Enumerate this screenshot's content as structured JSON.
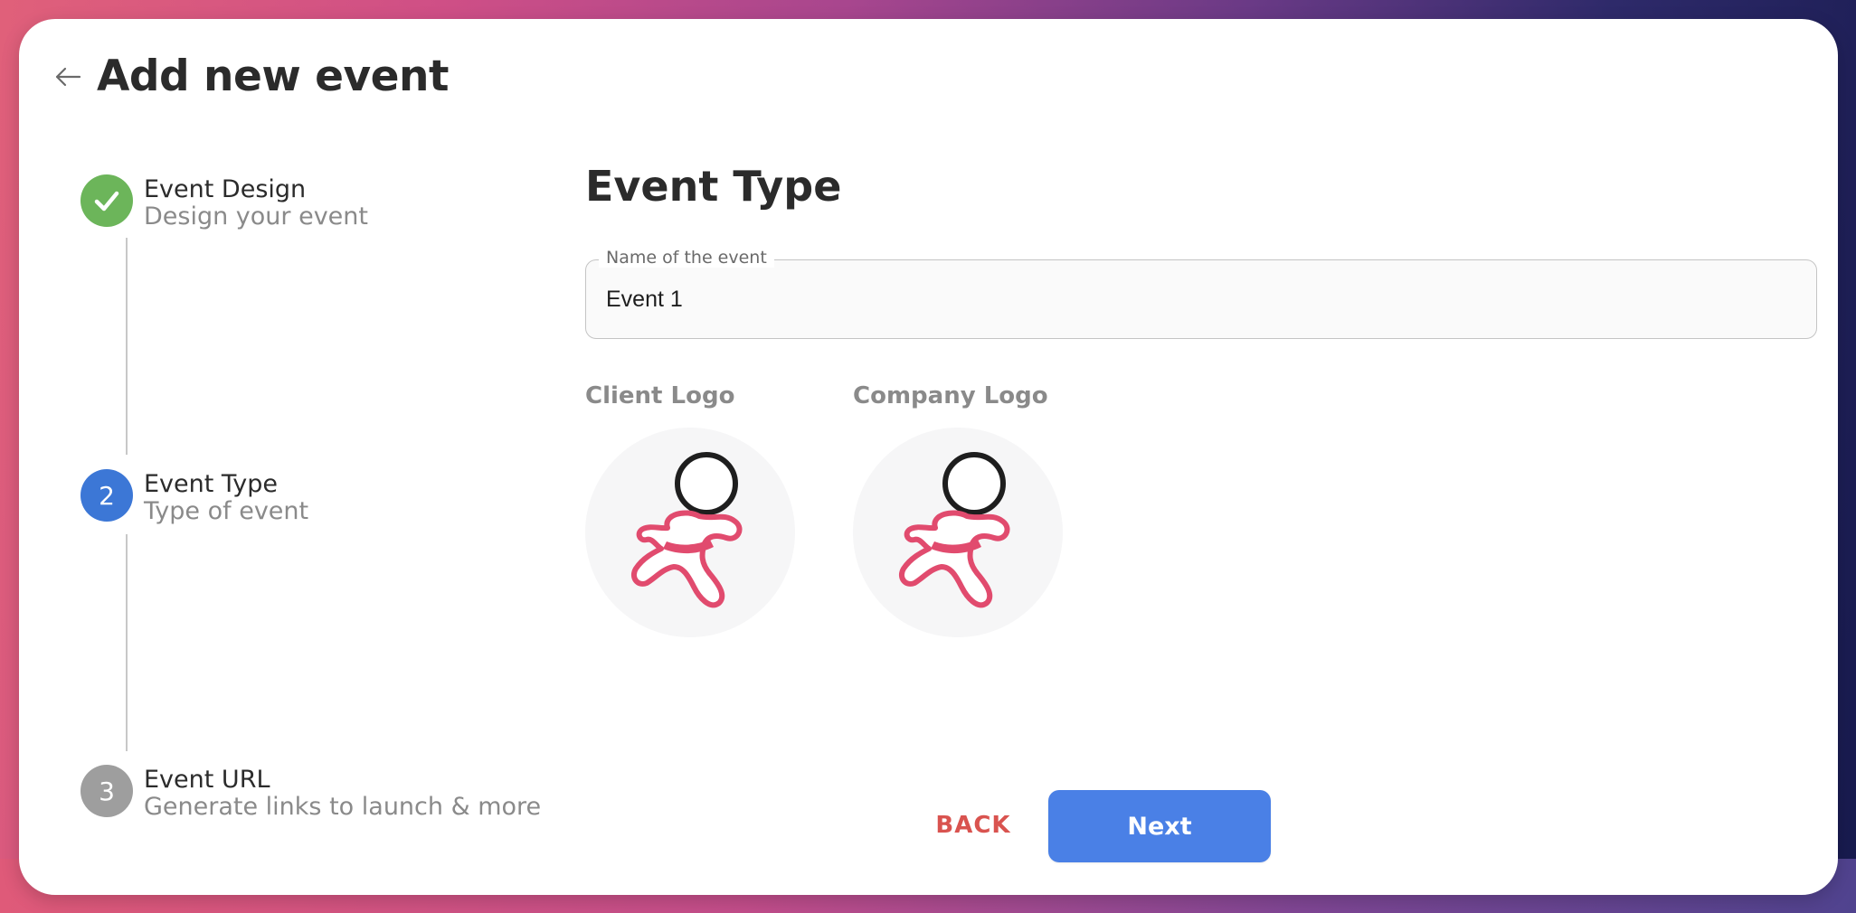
{
  "page": {
    "title": "Add new event"
  },
  "stepper": {
    "steps": [
      {
        "title": "Event Design",
        "subtitle": "Design your event",
        "state": "completed",
        "indicator": "check-icon",
        "color": "#6cb55a"
      },
      {
        "title": "Event Type",
        "subtitle": "Type of event",
        "state": "active",
        "indicator": "2",
        "color": "#3c77d6"
      },
      {
        "title": "Event URL",
        "subtitle": "Generate links to launch & more",
        "state": "pending",
        "indicator": "3",
        "color": "#9e9e9e"
      }
    ]
  },
  "main": {
    "section_title": "Event Type",
    "name_field": {
      "label": "Name of the event",
      "value": "Event 1"
    },
    "logos": [
      {
        "label": "Client Logo",
        "icon": "running-person-icon"
      },
      {
        "label": "Company Logo",
        "icon": "running-person-icon"
      }
    ]
  },
  "actions": {
    "back_label": "BACK",
    "next_label": "Next",
    "back_color": "#d9534f",
    "next_color": "#4a80e6"
  }
}
